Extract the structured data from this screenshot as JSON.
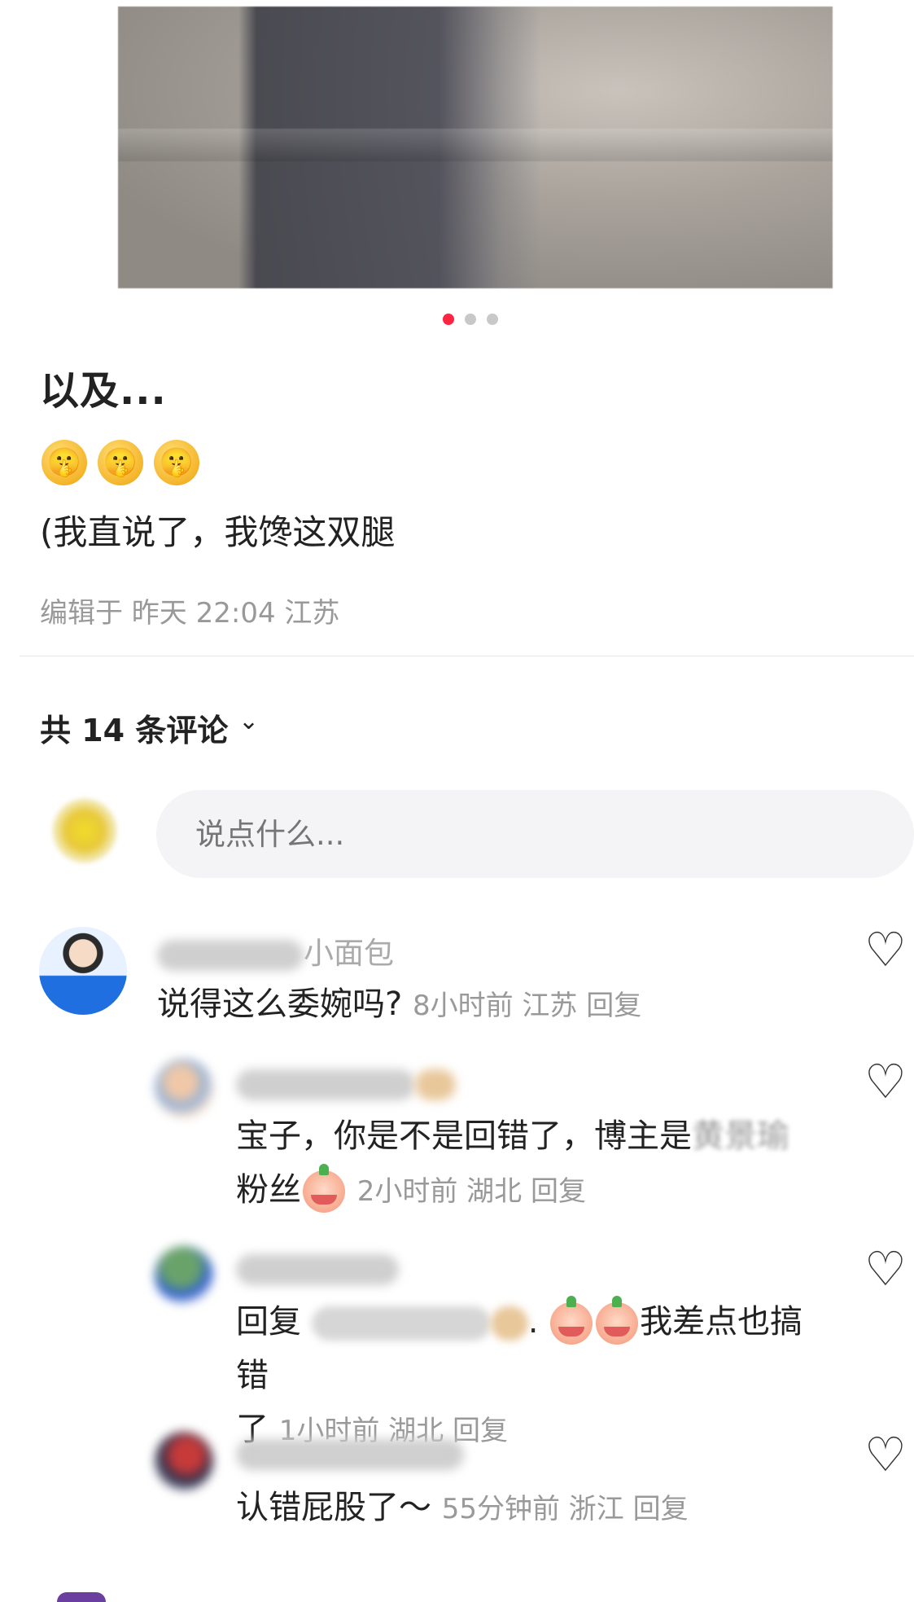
{
  "carousel": {
    "total": 3,
    "active": 0,
    "accent": "#ff2442"
  },
  "post": {
    "title": "以及...",
    "emoji_icon": "shushing-face",
    "emoji_count": 3,
    "body": "(我直说了，我馋这双腿",
    "edit_meta": "编辑于 昨天 22:04 江苏"
  },
  "comments_header": {
    "count_label": "共 14 条评论",
    "chevron_icon": "chevron-down-icon"
  },
  "comment_input": {
    "placeholder": "说点什么..."
  },
  "comments": [
    {
      "username_visible": "小面包",
      "text": "说得这么委婉吗?",
      "meta": "8小时前 江苏 回复"
    },
    {
      "text_line1_prefix": "宝子，你是不是回错了，博主是",
      "text_line1_suffix": "黄景瑜",
      "text_line2": "粉丝",
      "meta": "2小时前 湖北 回复"
    },
    {
      "reply_prefix": "回复",
      "text_line1_suffix": "我差点也搞错",
      "text_line2": "了",
      "meta": "1小时前 湖北 回复"
    },
    {
      "text": "认错屁股了～",
      "meta": "55分钟前 浙江 回复"
    }
  ],
  "heart_icon": "heart-outline-icon"
}
